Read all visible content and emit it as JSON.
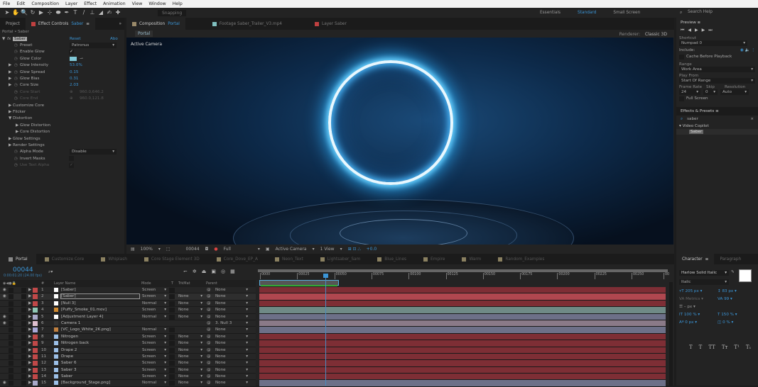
{
  "menu": [
    "File",
    "Edit",
    "Composition",
    "Layer",
    "Effect",
    "Animation",
    "View",
    "Window",
    "Help"
  ],
  "toolbar": {
    "snapping": "Snapping",
    "workspaces": [
      "Essentials",
      "Standard",
      "Small Screen"
    ],
    "active_workspace": "Standard",
    "search_placeholder": "Search Help",
    "tools": [
      "selection-tool",
      "hand-tool",
      "zoom-tool",
      "rotate-tool",
      "camera-tool",
      "pan-behind-tool",
      "ellipse-tool",
      "pen-tool",
      "type-tool",
      "brush-tool",
      "clone-stamp-tool",
      "eraser-tool",
      "roto-brush-tool",
      "puppet-pin-tool"
    ]
  },
  "left_panel": {
    "tabs": [
      "Project",
      "Effect Controls"
    ],
    "effect_tab_layer": "Saber",
    "breadcrumb": "Portal • Saber",
    "effect_name": "Saber",
    "reset": "Reset",
    "about": "Abo",
    "rows": [
      {
        "label": "Preset",
        "value": "Patronus",
        "type": "dropdown",
        "indent": 1
      },
      {
        "label": "Enable Glow",
        "value": "✓",
        "type": "check",
        "indent": 1
      },
      {
        "label": "Glow Color",
        "value": "",
        "type": "color",
        "color": "#7fc7d6",
        "indent": 1
      },
      {
        "label": "Glow Intensity",
        "value": "53.0%",
        "type": "num",
        "indent": 1,
        "tw": true
      },
      {
        "label": "Glow Spread",
        "value": "0.15",
        "type": "num",
        "indent": 1,
        "tw": true
      },
      {
        "label": "Glow Bias",
        "value": "0.31",
        "type": "num",
        "indent": 1,
        "tw": true
      },
      {
        "label": "Core Size",
        "value": "2.03",
        "type": "num",
        "indent": 1,
        "tw": true
      },
      {
        "label": "Core Start",
        "value": "960.0,646.2",
        "type": "dim",
        "indent": 1
      },
      {
        "label": "Core End",
        "value": "960.0,121.8",
        "type": "dim",
        "indent": 1
      },
      {
        "label": "Customize Core",
        "type": "group",
        "indent": 0
      },
      {
        "label": "Flicker",
        "type": "group",
        "indent": 0
      },
      {
        "label": "Distortion",
        "type": "groupopen",
        "indent": 0
      },
      {
        "label": "Glow Distortion",
        "type": "group",
        "indent": 1
      },
      {
        "label": "Core Distortion",
        "type": "group",
        "indent": 1
      },
      {
        "label": "Glow Settings",
        "type": "group",
        "indent": 0
      },
      {
        "label": "Render Settings",
        "type": "group",
        "indent": 0
      },
      {
        "label": "Alpha Mode",
        "value": "Disable",
        "type": "dropdown",
        "indent": 1
      },
      {
        "label": "Invert Masks",
        "value": "",
        "type": "check",
        "indent": 1
      },
      {
        "label": "Use Text Alpha",
        "value": "✓",
        "type": "checkdim",
        "indent": 1
      }
    ]
  },
  "comp_panel": {
    "tabs": [
      {
        "label": "Composition",
        "name": "Portal",
        "color": "#9a8a6a"
      },
      {
        "label": "Footage Saber_Trailer_V3.mp4",
        "color": "#7fbfbf"
      },
      {
        "label": "Layer Saber",
        "color": "#c04040"
      }
    ],
    "subtab": "Portal",
    "renderer_label": "Renderer:",
    "renderer": "Classic 3D",
    "viewer_label": "Active Camera",
    "bottom": {
      "zoom": "100%",
      "timecode": "00044",
      "resolution": "Full",
      "camera": "Active Camera",
      "views": "1 View",
      "exposure": "+0.0"
    }
  },
  "preview": {
    "title": "Preview",
    "shortcut_label": "Shortcut",
    "shortcut": "Numpad 0",
    "include_label": "Include:",
    "cache": "Cache Before Playback",
    "range_label": "Range",
    "range": "Work Area",
    "play_from_label": "Play From",
    "play_from": "Start Of Range",
    "frame_rate_label": "Frame Rate",
    "skip_label": "Skip",
    "resolution_label": "Resolution",
    "frame_rate": "24",
    "skip": "0",
    "resolution": "Auto",
    "full_screen": "Full Screen"
  },
  "effects_presets": {
    "title": "Effects & Presets",
    "search": "saber",
    "category": "Video Copilot",
    "item": "Saber"
  },
  "timeline": {
    "tabs": [
      "Portal",
      "Customize Core",
      "Whiplash",
      "Core Stage Element 3D",
      "Core_Dove_EP_A",
      "Neon_Text",
      "Lightsaber_Sam",
      "Blue_Lines",
      "Empire",
      "Warm",
      "Random_Examples"
    ],
    "timecode": "00044",
    "timecode_sub": "0:00:01:20 (24.00 fps)",
    "search_placeholder": "",
    "headers": {
      "name": "Layer Name",
      "mode": "Mode",
      "t": "T",
      "trkmat": "TrkMat",
      "parent": "Parent"
    },
    "ruler": [
      "0000",
      "00025",
      "00050",
      "00075",
      "00100",
      "00125",
      "00150",
      "00175",
      "00200",
      "00225",
      "00250",
      "00"
    ],
    "layers": [
      {
        "num": "1",
        "name": "[Saber]",
        "mode": "Screen",
        "trkmat": "",
        "parent": "None",
        "label": "#c04848",
        "icon": "#ffffff",
        "bar": "#7e2e35",
        "eye": true
      },
      {
        "num": "2",
        "name": "[Saber]",
        "mode": "Screen",
        "trkmat": "None",
        "parent": "None",
        "label": "#c04848",
        "icon": "#ffffff",
        "bar": "#b0474f",
        "eye": true,
        "selected": true
      },
      {
        "num": "3",
        "name": "[Null 3]",
        "mode": "Normal",
        "trkmat": "None",
        "parent": "None",
        "label": "#c04848",
        "icon": "#ffffff",
        "bar": "#7e2e35"
      },
      {
        "num": "4",
        "name": "[Puffy_Smoke_01.mov]",
        "mode": "Screen",
        "trkmat": "None",
        "parent": "None",
        "label": "#8fc7b5",
        "icon": "#d08a30",
        "bar": "#6f8a86"
      },
      {
        "num": "5",
        "name": "[Adjustment Layer 4]",
        "mode": "Normal",
        "trkmat": "None",
        "parent": "None",
        "label": "#a9a9c9",
        "icon": "#ffffff",
        "bar": "#6d7088",
        "eye": true
      },
      {
        "num": "6",
        "name": "Camera 1",
        "mode": "",
        "trkmat": "",
        "parent": "3. Null 3",
        "label": "#e0c0d0",
        "icon": "#333333",
        "bar": "#8a7a88",
        "eye": true
      },
      {
        "num": "7",
        "name": "[VC_Logo_White_2K.png]",
        "mode": "Normal",
        "trkmat": "",
        "parent": "None",
        "label": "#a9a9d9",
        "icon": "#c08040",
        "bar": "#6d7088"
      },
      {
        "num": "8",
        "name": "Nitrogen",
        "mode": "Screen",
        "trkmat": "None",
        "parent": "None",
        "label": "#c04848",
        "icon": "#9cc0e8",
        "bar": "#7e2e35"
      },
      {
        "num": "9",
        "name": "Nitrogen back",
        "mode": "Screen",
        "trkmat": "None",
        "parent": "None",
        "label": "#c04848",
        "icon": "#9cc0e8",
        "bar": "#7e2e35"
      },
      {
        "num": "10",
        "name": "Drape 2",
        "mode": "Screen",
        "trkmat": "None",
        "parent": "None",
        "label": "#c04848",
        "icon": "#9cc0e8",
        "bar": "#7e2e35"
      },
      {
        "num": "11",
        "name": "Drape",
        "mode": "Screen",
        "trkmat": "None",
        "parent": "None",
        "label": "#c04848",
        "icon": "#9cc0e8",
        "bar": "#7e2e35"
      },
      {
        "num": "12",
        "name": "Saber 6",
        "mode": "Screen",
        "trkmat": "None",
        "parent": "None",
        "label": "#c04848",
        "icon": "#9cc0e8",
        "bar": "#7e2e35"
      },
      {
        "num": "13",
        "name": "Saber 3",
        "mode": "Screen",
        "trkmat": "None",
        "parent": "None",
        "label": "#c04848",
        "icon": "#9cc0e8",
        "bar": "#7e2e35"
      },
      {
        "num": "14",
        "name": "Saber",
        "mode": "Screen",
        "trkmat": "None",
        "parent": "None",
        "label": "#c04848",
        "icon": "#9cc0e8",
        "bar": "#7e2e35"
      },
      {
        "num": "15",
        "name": "[Background_Stage.png]",
        "mode": "Normal",
        "trkmat": "None",
        "parent": "None",
        "label": "#a9a9c9",
        "icon": "#9cc0e8",
        "bar": "#6d7088",
        "eye": true
      }
    ]
  },
  "character": {
    "tabs": [
      "Character",
      "Paragraph"
    ],
    "font": "Harlow Solid Italic",
    "style": "Italic",
    "size": "205 px",
    "leading": "83 px",
    "kerning": "Metrics",
    "tracking": "99",
    "stroke": "– px",
    "vscale": "100 %",
    "hscale": "150 %",
    "baseline": "0 px",
    "tsume": "0 %",
    "styles": [
      "T",
      "T",
      "TT",
      "Tт",
      "T¹",
      "T₁"
    ]
  },
  "colors": {
    "accent": "#3b95d6",
    "panel": "#232323",
    "menubar": "#f2f2f2"
  }
}
